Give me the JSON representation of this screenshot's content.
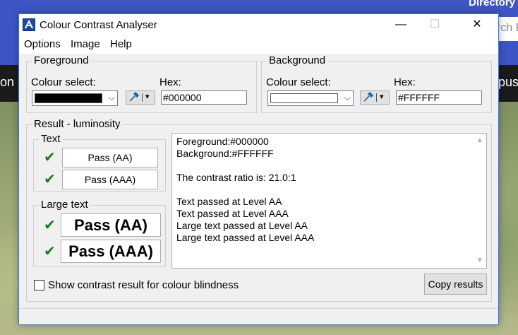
{
  "background_site": {
    "directory": "Directory",
    "search_fragment": "rch B",
    "nav_left": "on",
    "nav_right": "pus"
  },
  "window": {
    "title": "Colour Contrast Analyser",
    "minimize": "—",
    "maximize": "☐",
    "close": "✕"
  },
  "menu": {
    "items": [
      "Options",
      "Image",
      "Help"
    ]
  },
  "foreground": {
    "group_label": "Foreground",
    "colour_select_label": "Colour select:",
    "hex_label": "Hex:",
    "hex_value": "#000000",
    "swatch_color": "#000000"
  },
  "background": {
    "group_label": "Background",
    "colour_select_label": "Colour select:",
    "hex_label": "Hex:",
    "hex_value": "#FFFFFF",
    "swatch_color": "#FFFFFF"
  },
  "result": {
    "group_label": "Result - luminosity",
    "text_group_label": "Text",
    "text_aa": "Pass (AA)",
    "text_aaa": "Pass (AAA)",
    "large_group_label": "Large text",
    "large_aa": "Pass (AA)",
    "large_aaa": "Pass (AAA)",
    "details": [
      "Foreground:#000000",
      "Background:#FFFFFF",
      "",
      "The contrast ratio is: 21.0:1",
      "",
      "Text passed at Level AA",
      "Text passed at Level AAA",
      "Large text passed at Level AA",
      "Large text passed at Level AAA"
    ]
  },
  "colour_blindness_checkbox": {
    "label": "Show contrast result for colour blindness",
    "checked": false
  },
  "copy_button": "Copy results",
  "icons": {
    "check": "✔",
    "chevron": "⌵",
    "eyedropper": "✎",
    "dropdown_arrow": "▾",
    "scroll_up": "▲",
    "scroll_down": "▼"
  },
  "colors": {
    "pass_check": "#1a7a1a",
    "site_header": "#3e56c4"
  }
}
